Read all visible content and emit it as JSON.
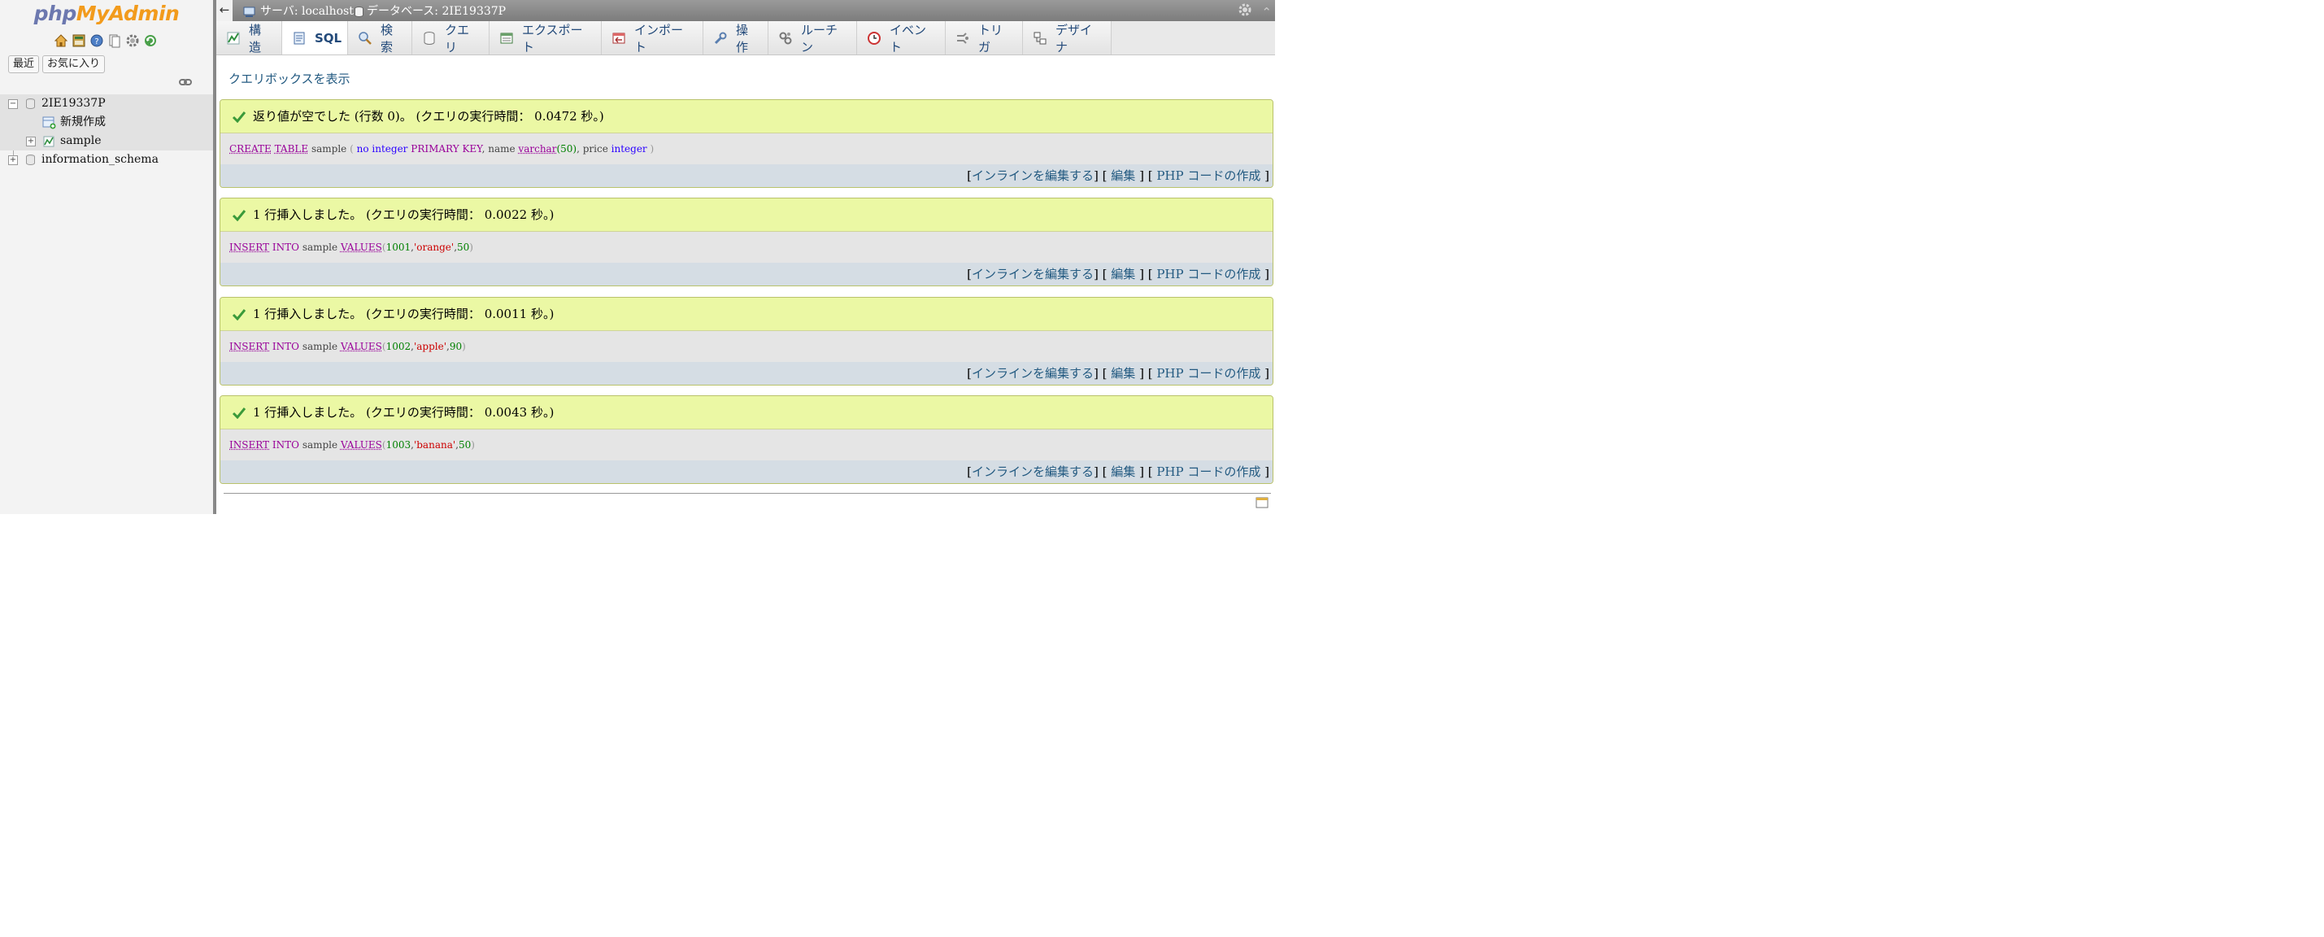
{
  "logo": {
    "php": "php",
    "myadmin": "MyAdmin"
  },
  "nav": {
    "icons": [
      "home-icon",
      "sql-window-icon",
      "help-icon",
      "docs-icon",
      "settings-icon",
      "reload-icon"
    ],
    "recent_label": "最近",
    "favorites_label": "お気に入り",
    "tree": [
      {
        "label": "2IE19337P",
        "expanded": true
      },
      {
        "label": "新規作成"
      },
      {
        "label": "sample"
      },
      {
        "label": "information_schema",
        "expanded": false
      }
    ]
  },
  "breadcrumb": {
    "server": "サーバ: localhost »",
    "database": "データベース: 2IE19337P"
  },
  "tabs": [
    {
      "label": "構造",
      "icon": "structure-icon"
    },
    {
      "label": "SQL",
      "icon": "sql-icon",
      "active": true
    },
    {
      "label": "検索",
      "icon": "search-icon"
    },
    {
      "label": "クエリ",
      "icon": "query-icon"
    },
    {
      "label": "エクスポート",
      "icon": "export-icon"
    },
    {
      "label": "インポート",
      "icon": "import-icon"
    },
    {
      "label": "操作",
      "icon": "wrench-icon"
    },
    {
      "label": "ルーチン",
      "icon": "routines-icon"
    },
    {
      "label": "イベント",
      "icon": "events-icon"
    },
    {
      "label": "トリガ",
      "icon": "triggers-icon"
    },
    {
      "label": "デザイナ",
      "icon": "designer-icon"
    }
  ],
  "main": {
    "show_query_box": "クエリボックスを表示",
    "results": [
      {
        "message": "返り値が空でした (行数 0)。 (クエリの実行時間： 0.0472 秒。)",
        "sql": {
          "kw1": "CREATE",
          "kw2": "TABLE",
          "table": "sample",
          "open": "(",
          "col1": "no",
          "type1": "integer",
          "pk": "PRIMARY KEY",
          "c1": ",",
          "col2": "name",
          "type2": "varchar",
          "len": "(50)",
          "c2": ",",
          "col3": "price",
          "type3": "integer",
          "close": ")"
        }
      },
      {
        "message": "1 行挿入しました。 (クエリの実行時間： 0.0022 秒。)",
        "sql": {
          "kw1": "INSERT",
          "kw2": "INTO",
          "table": "sample",
          "values": "VALUES",
          "open": "(",
          "v1": "1001",
          "v2": "'orange'",
          "v3": "50",
          "close": ")"
        }
      },
      {
        "message": "1 行挿入しました。 (クエリの実行時間： 0.0011 秒。)",
        "sql": {
          "kw1": "INSERT",
          "kw2": "INTO",
          "table": "sample",
          "values": "VALUES",
          "open": "(",
          "v1": "1002",
          "v2": "'apple'",
          "v3": "90",
          "close": ")"
        }
      },
      {
        "message": "1 行挿入しました。 (クエリの実行時間： 0.0043 秒。)",
        "sql": {
          "kw1": "INSERT",
          "kw2": "INTO",
          "table": "sample",
          "values": "VALUES",
          "open": "(",
          "v1": "1003",
          "v2": "'banana'",
          "v3": "50",
          "close": ")"
        }
      }
    ],
    "actions": {
      "inline_edit": "インラインを編集する",
      "edit": "編集",
      "php_code": "PHP コードの作成"
    }
  },
  "colors": {
    "success_bg": "#ebf8a4",
    "link": "#235a81",
    "keyword": "#990099",
    "string": "#cc0000",
    "number": "#008000"
  }
}
